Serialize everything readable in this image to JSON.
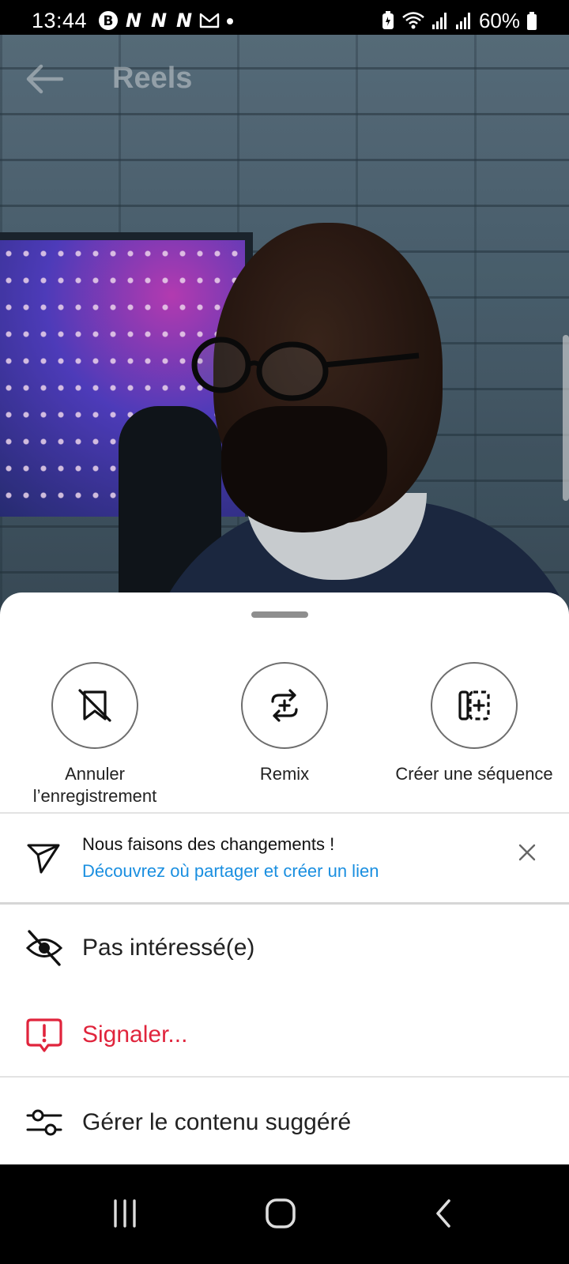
{
  "status_bar": {
    "time": "13:44",
    "battery": "60%",
    "notification_icons": [
      "bitcoin-icon",
      "n-icon",
      "n-icon",
      "n-icon",
      "gmail-icon",
      "dot-icon"
    ],
    "system_icons": [
      "battery-saver-icon",
      "wifi-icon",
      "signal-icon",
      "signal-icon",
      "battery-icon"
    ]
  },
  "header": {
    "title": "Reels",
    "back_icon": "arrow-left-icon"
  },
  "sheet": {
    "actions": [
      {
        "label": "Annuler l’enregistrement",
        "icon": "bookmark-slash-icon"
      },
      {
        "label": "Remix",
        "icon": "remix-icon"
      },
      {
        "label": "Créer une séquence",
        "icon": "sequence-icon"
      }
    ],
    "promo": {
      "title": "Nous faisons des changements !",
      "link": "Découvrez où partager et créer un lien",
      "icon": "send-icon",
      "close_icon": "close-icon"
    },
    "menu": {
      "not_interested": "Pas intéressé(e)",
      "report": "Signaler...",
      "manage": "Gérer le contenu suggéré"
    }
  },
  "colors": {
    "link": "#1a8fe0",
    "danger": "#e0243c",
    "sheet_bg": "#ffffff"
  },
  "nav_bar": {
    "buttons": [
      "recents-icon",
      "home-icon",
      "back-icon"
    ]
  }
}
